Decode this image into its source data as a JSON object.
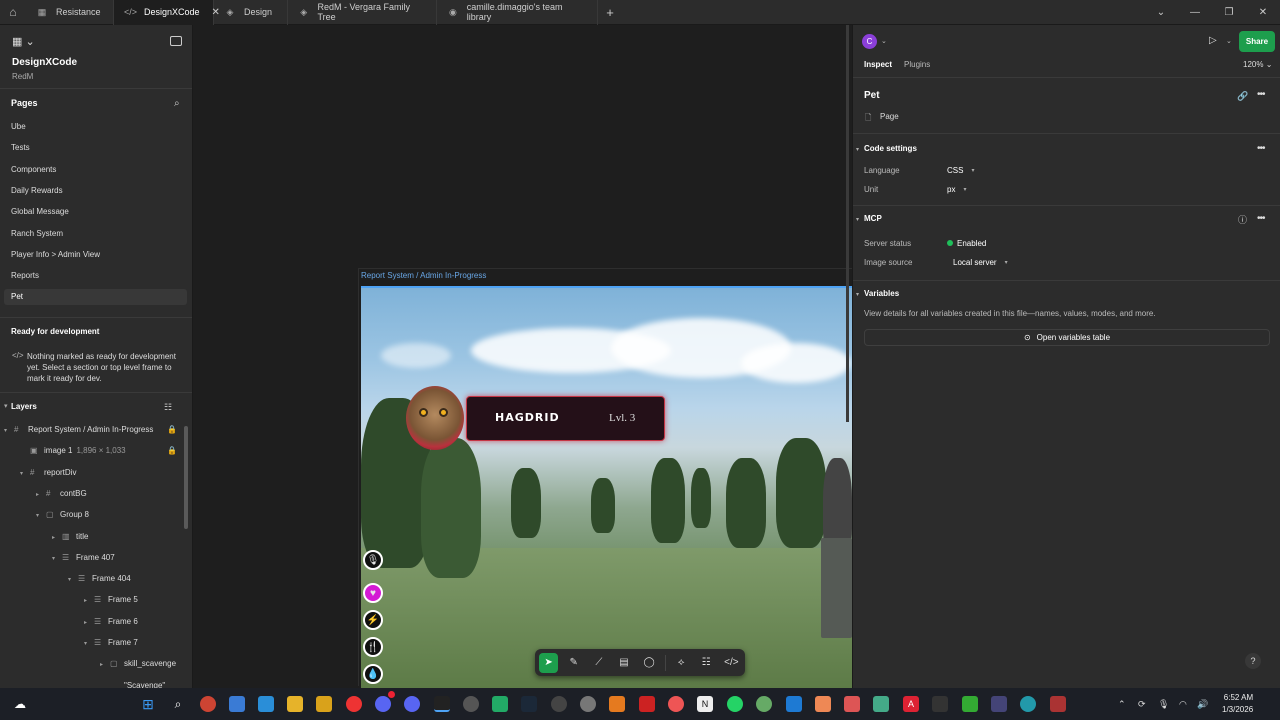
{
  "tabs": [
    {
      "label": "Resistance",
      "icon": "grid-icon",
      "active": false
    },
    {
      "label": "DesignXCode",
      "icon": "code-icon",
      "active": true
    },
    {
      "label": "Design",
      "icon": "figma-icon",
      "active": false
    },
    {
      "label": "RedM - Vergara Family Tree",
      "icon": "figma-icon",
      "active": false
    },
    {
      "label": "camille.dimaggio's team library",
      "icon": "library-icon",
      "active": false
    }
  ],
  "left": {
    "project_name": "DesignXCode",
    "project_sub": "RedM",
    "pages_header": "Pages",
    "pages": [
      "Ube",
      "Tests",
      "Components",
      "Daily Rewards",
      "Global Message",
      "Ranch System",
      "Player Info > Admin View",
      "Reports",
      "Pet"
    ],
    "selected_page": "Pet",
    "ready_header": "Ready for development",
    "ready_text": "Nothing marked as ready for development yet. Select a section or top level frame to mark it ready for dev.",
    "layers_header": "Layers",
    "layers": [
      {
        "name": "Report System / Admin In-Progress",
        "indent": 0,
        "icon": "#",
        "caret": "▾",
        "locked": true
      },
      {
        "name": "image 1",
        "extra": "1,896 × 1,033",
        "indent": 1,
        "icon": "▣",
        "caret": "",
        "locked": true
      },
      {
        "name": "reportDiv",
        "indent": 1,
        "icon": "#",
        "caret": "▾",
        "locked": false
      },
      {
        "name": "contBG",
        "indent": 2,
        "icon": "#",
        "caret": "▸",
        "locked": false
      },
      {
        "name": "Group 8",
        "indent": 2,
        "icon": "▢",
        "caret": "▾",
        "locked": false
      },
      {
        "name": "title",
        "indent": 3,
        "icon": "▥",
        "caret": "▸",
        "locked": false
      },
      {
        "name": "Frame 407",
        "indent": 3,
        "icon": "☰",
        "caret": "▾",
        "locked": false
      },
      {
        "name": "Frame 404",
        "indent": 4,
        "icon": "☰",
        "caret": "▾",
        "locked": false
      },
      {
        "name": "Frame 5",
        "indent": 5,
        "icon": "☰",
        "caret": "▸",
        "locked": false
      },
      {
        "name": "Frame 6",
        "indent": 5,
        "icon": "☰",
        "caret": "▸",
        "locked": false
      },
      {
        "name": "Frame 7",
        "indent": 5,
        "icon": "☰",
        "caret": "▾",
        "locked": false
      },
      {
        "name": "skill_scavenge",
        "indent": 6,
        "icon": "▢",
        "caret": "▸",
        "locked": false
      },
      {
        "name": "\"Scavenge\"",
        "indent": 6,
        "icon": "",
        "caret": "",
        "locked": false
      }
    ]
  },
  "canvas": {
    "frame_label": "Report System / Admin In-Progress",
    "pet_name": "HAGDRID",
    "pet_level": "Lvl. 3"
  },
  "right": {
    "avatar": "C",
    "share": "Share",
    "tab_inspect": "Inspect",
    "tab_plugins": "Plugins",
    "zoom": "120%",
    "title": "Pet",
    "page_label": "Page",
    "code_settings": "Code settings",
    "language_label": "Language",
    "language_value": "CSS",
    "unit_label": "Unit",
    "unit_value": "px",
    "mcp": "MCP",
    "server_status_label": "Server status",
    "server_status_value": "Enabled",
    "image_source_label": "Image source",
    "image_source_value": "Local server",
    "variables": "Variables",
    "variables_desc": "View details for all variables created in this file—names, values, modes, and more.",
    "open_variables": "Open variables table",
    "help": "?"
  },
  "taskbar": {
    "time": "6:52 AM",
    "date": "1/3/2026"
  },
  "colors": {
    "accent_green": "#1d9e4d",
    "selection_blue": "#4ea3f5",
    "avatar_purple": "#8b3fd9"
  }
}
